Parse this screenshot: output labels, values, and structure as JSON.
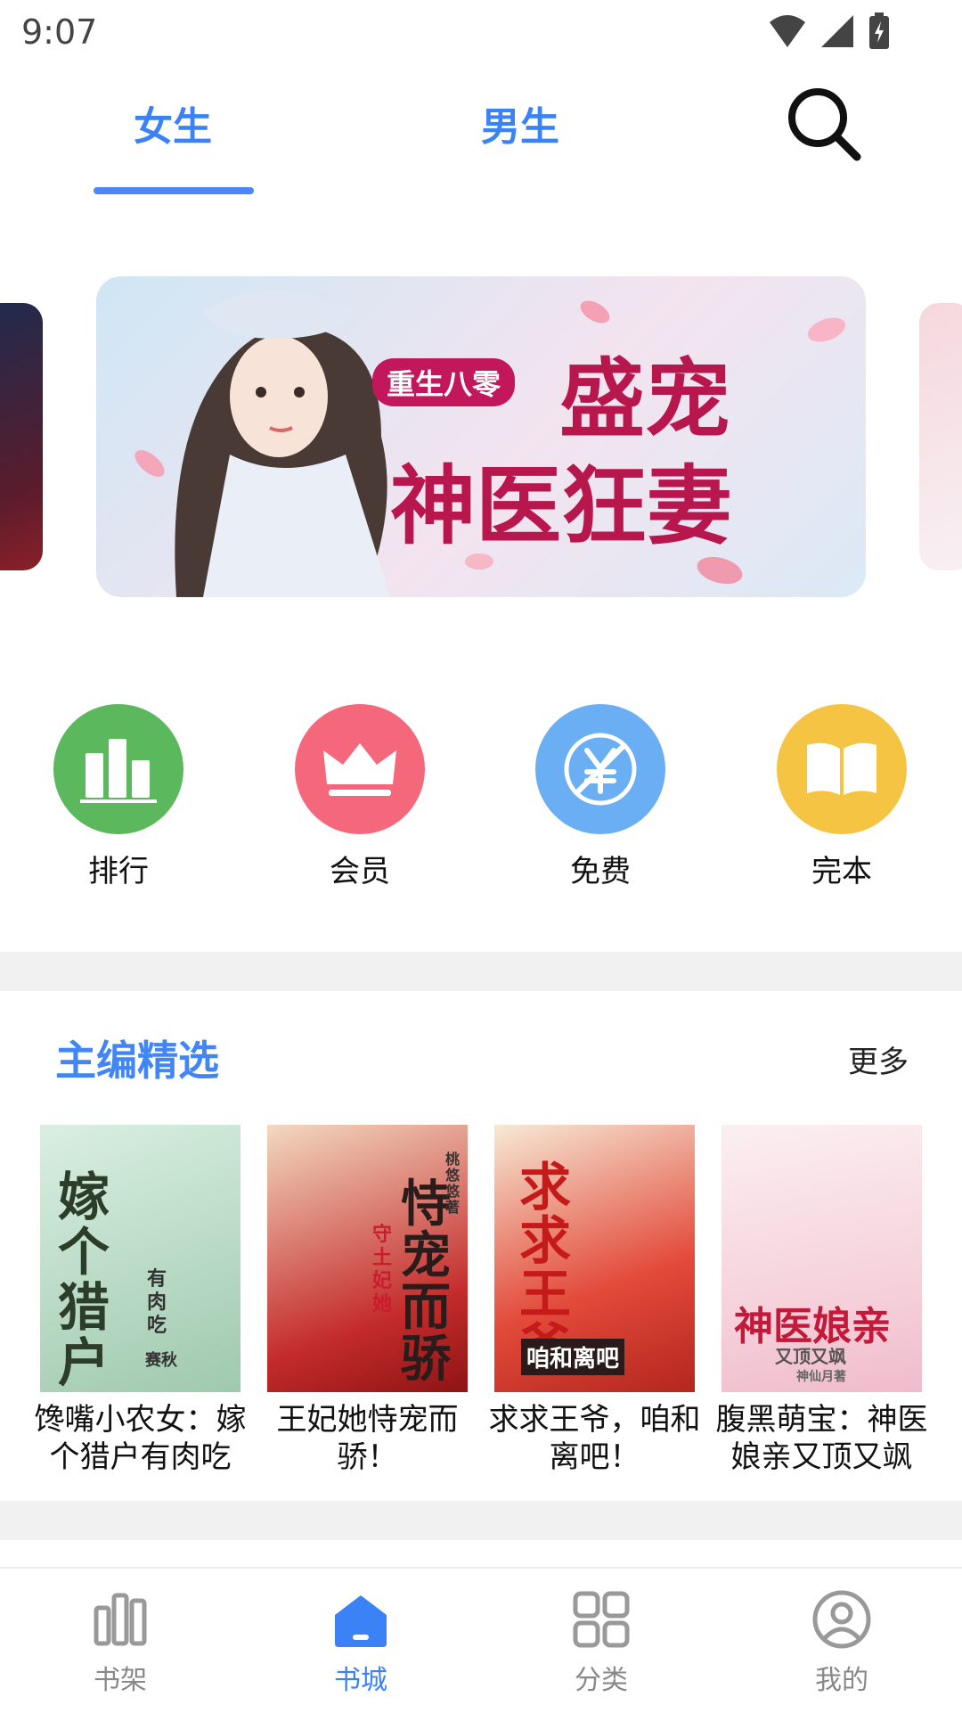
{
  "status_bar": {
    "time": "9:07"
  },
  "top_tabs": [
    {
      "label": "女生",
      "active": true
    },
    {
      "label": "男生",
      "active": false
    }
  ],
  "banner": {
    "badge": "重生八零",
    "title_line1": "盛宠",
    "title_line2": "神医狂妻"
  },
  "shortcuts": [
    {
      "label": "排行",
      "icon": "ranking-icon",
      "color": "#5cb85c"
    },
    {
      "label": "会员",
      "icon": "crown-icon",
      "color": "#f5677a"
    },
    {
      "label": "免费",
      "icon": "free-yuan-icon",
      "color": "#6aaef4"
    },
    {
      "label": "完本",
      "icon": "open-book-icon",
      "color": "#f5c443"
    }
  ],
  "section": {
    "title": "主编精选",
    "more": "更多"
  },
  "books": [
    {
      "title": "馋嘴小农女：嫁个猎户有肉吃",
      "cover_text": "嫁个猎户",
      "cover_sub": "有肉吃",
      "cover_author": "赛秋"
    },
    {
      "title": "王妃她恃宠而骄！",
      "cover_text": "恃宠而骄",
      "cover_sub": "守土妃她",
      "cover_author": "桃悠悠著"
    },
    {
      "title": "求求王爷，咱和离吧！",
      "cover_text": "求求王爷",
      "cover_sub": "咱和离吧",
      "cover_author": ""
    },
    {
      "title": "腹黑萌宝：神医娘亲又顶又飒",
      "cover_text": "神医娘亲",
      "cover_sub": "又顶又飒",
      "cover_author": "神仙月著"
    }
  ],
  "bottom_nav": [
    {
      "label": "书架",
      "active": false
    },
    {
      "label": "书城",
      "active": true
    },
    {
      "label": "分类",
      "active": false
    },
    {
      "label": "我的",
      "active": false
    }
  ],
  "colors": {
    "accent": "#3b82f6",
    "divider": "#f1f1f1"
  }
}
